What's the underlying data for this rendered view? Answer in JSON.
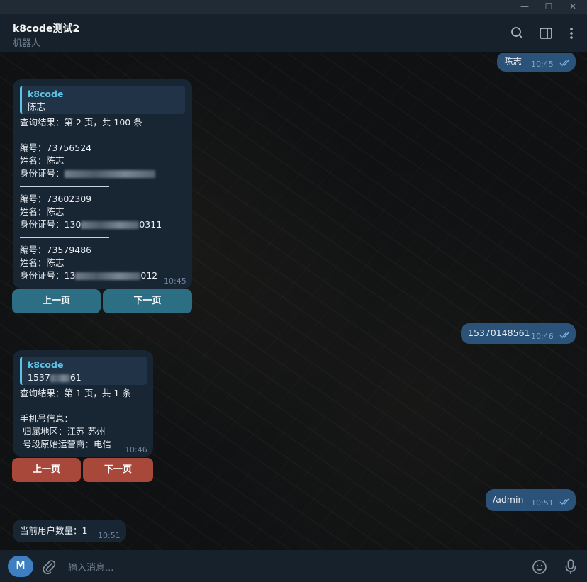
{
  "window": {
    "minimize_glyph": "—",
    "maximize_glyph": "☐",
    "close_glyph": "✕"
  },
  "header": {
    "title": "k8code测试2",
    "subtitle": "机器人"
  },
  "messages": {
    "m1": {
      "text": "陈志",
      "time": "10:45"
    },
    "m2": {
      "reply_name": "k8code",
      "reply_text": "陈志",
      "lines": [
        "查询结果：第 2 页，共 100 条",
        "编号：73756524",
        "姓名：陈志",
        "身份证号：",
        "编号：73602309",
        "姓名：陈志",
        "身份证号：130",
        "编号：73579486",
        "姓名：陈志",
        "身份证号：13"
      ],
      "id_tail_2": "0311",
      "id_tail_3": "012",
      "time": "10:45",
      "buttons": [
        "上一页",
        "下一页"
      ]
    },
    "m3": {
      "text": "15370148561",
      "time": "10:46"
    },
    "m4": {
      "reply_name": "k8code",
      "reply_head": "1537",
      "reply_tail": "61",
      "lines": [
        "查询结果：第 1 页，共 1 条",
        "手机号信息：",
        " 归属地区：江苏 苏州",
        " 号段原始运营商：电信"
      ],
      "time": "10:46",
      "buttons": [
        "上一页",
        "下一页"
      ]
    },
    "m5": {
      "text": "/admin",
      "time": "10:51"
    },
    "m6": {
      "text": "当前用户数量：1",
      "time": "10:51"
    }
  },
  "composer": {
    "avatar_letter": "M",
    "placeholder": "输入消息..."
  },
  "colors": {
    "incoming": "#182533",
    "outgoing": "#2b5278",
    "accent": "#5ec4e6",
    "button_blue": "#2c6e84",
    "button_red": "#a8483a"
  }
}
